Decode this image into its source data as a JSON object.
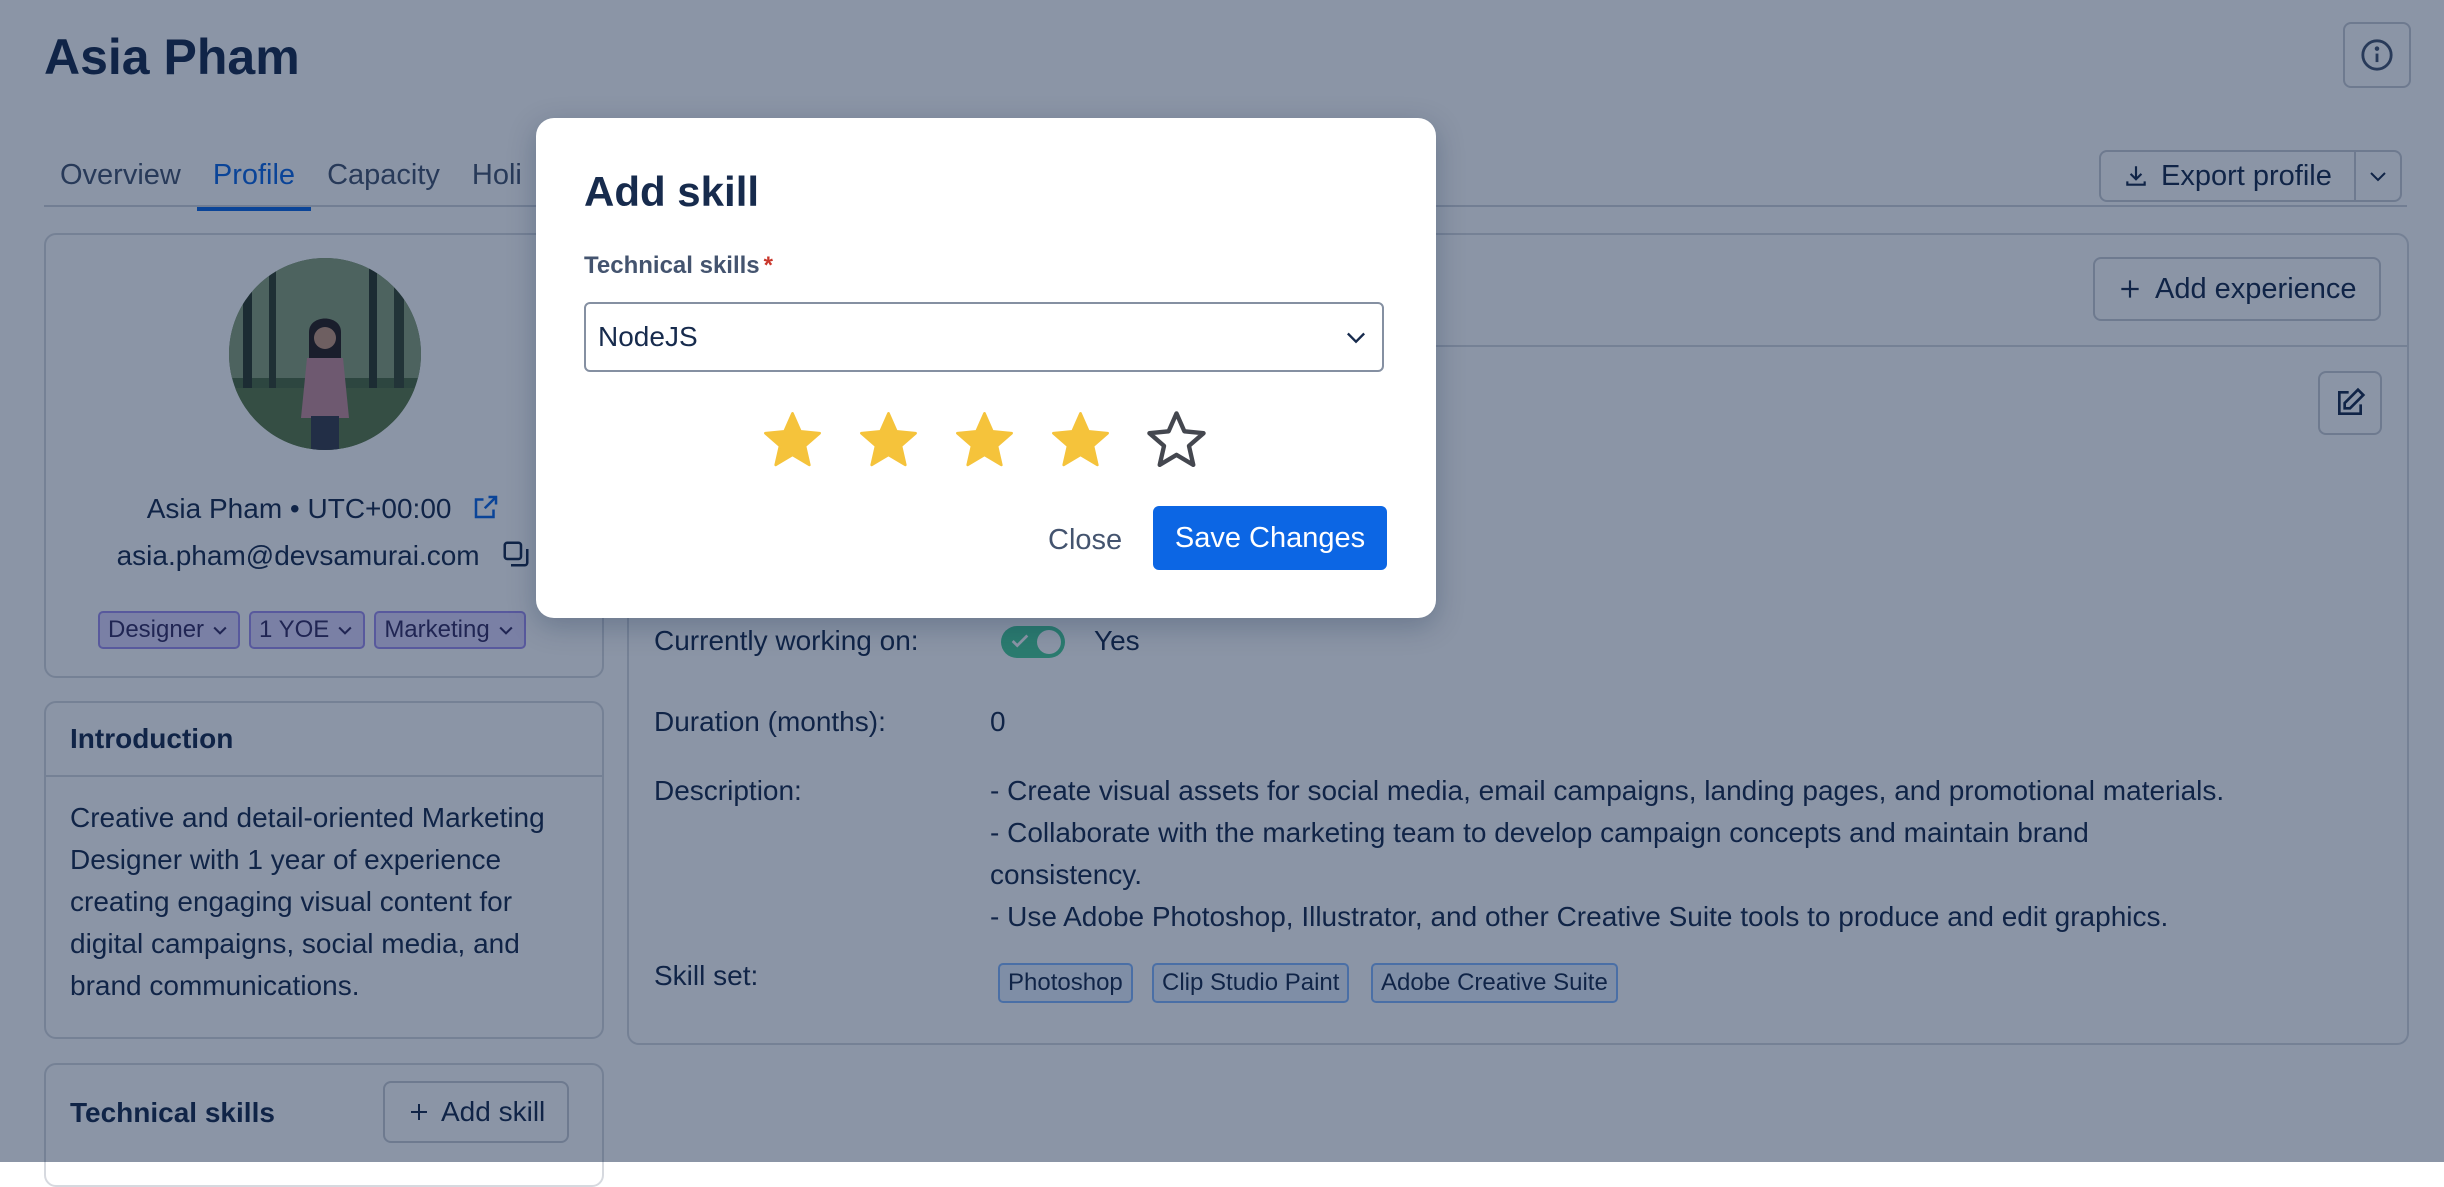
{
  "page": {
    "title": "Asia Pham"
  },
  "tabs": [
    {
      "label": "Overview"
    },
    {
      "label": "Profile"
    },
    {
      "label": "Capacity"
    },
    {
      "label": "Holi"
    }
  ],
  "actions": {
    "export_label": "Export profile"
  },
  "profile": {
    "name_line": "Asia Pham • UTC+00:00",
    "email": "asia.pham@devsamurai.com",
    "tags": [
      {
        "label": "Designer"
      },
      {
        "label": "1 YOE"
      },
      {
        "label": "Marketing"
      }
    ]
  },
  "introduction": {
    "title": "Introduction",
    "lines": [
      "Creative and detail-oriented Marketing",
      "Designer with 1 year of experience",
      "creating engaging visual content for",
      "digital campaigns, social media, and",
      "brand communications."
    ]
  },
  "technical_skills": {
    "title": "Technical skills",
    "add_label": "Add skill"
  },
  "experience": {
    "add_label": "Add experience",
    "currently_working_label": "Currently working on:",
    "currently_working_value": "Yes",
    "duration_label": "Duration (months):",
    "duration_value": "0",
    "description_label": "Description:",
    "description_lines": [
      "- Create visual assets for social media, email campaigns, landing pages, and promotional materials.",
      "- Collaborate with the marketing team to develop campaign concepts and maintain brand",
      "consistency.",
      "- Use Adobe Photoshop, Illustrator, and other Creative Suite tools to produce and edit graphics."
    ],
    "skillset_label": "Skill set:",
    "skills": [
      "Photoshop",
      "Clip Studio Paint",
      "Adobe Creative Suite"
    ]
  },
  "modal": {
    "title": "Add skill",
    "field_label": "Technical skills",
    "required_mark": "*",
    "selected_value": "NodeJS",
    "rating": 4,
    "rating_max": 5,
    "close_label": "Close",
    "save_label": "Save Changes"
  },
  "colors": {
    "primary": "#0c66e4",
    "star_filled": "#f5c33b",
    "star_outline": "#44474f",
    "overlay": "#091e42",
    "tag_bg": "#dfd8fd",
    "chip_bg": "#e9f2ff"
  }
}
